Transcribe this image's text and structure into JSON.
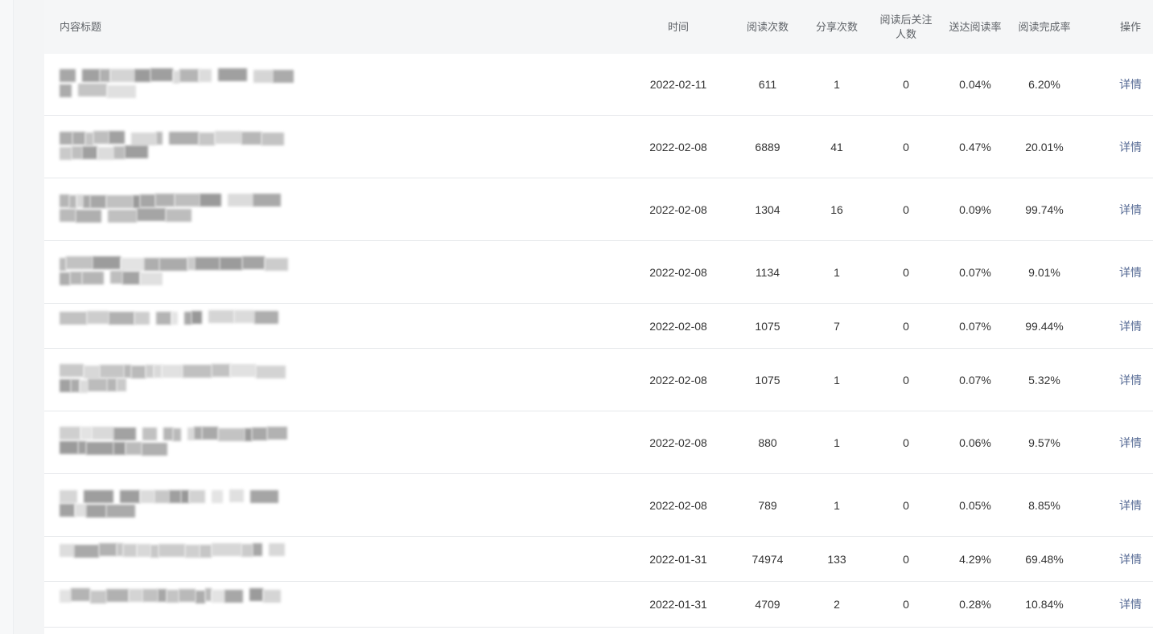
{
  "columns": {
    "title": "内容标题",
    "time": "时间",
    "reads": "阅读次数",
    "shares": "分享次数",
    "follows": "阅读后关注人数",
    "delivery_rate": "送达阅读率",
    "completion_rate": "阅读完成率",
    "action": "操作"
  },
  "rows": [
    {
      "time": "2022-02-11",
      "reads": "611",
      "shares": "1",
      "follows": "0",
      "delivery_rate": "0.04%",
      "completion_rate": "6.20%",
      "action": "详情"
    },
    {
      "time": "2022-02-08",
      "reads": "6889",
      "shares": "41",
      "follows": "0",
      "delivery_rate": "0.47%",
      "completion_rate": "20.01%",
      "action": "详情"
    },
    {
      "time": "2022-02-08",
      "reads": "1304",
      "shares": "16",
      "follows": "0",
      "delivery_rate": "0.09%",
      "completion_rate": "99.74%",
      "action": "详情"
    },
    {
      "time": "2022-02-08",
      "reads": "1134",
      "shares": "1",
      "follows": "0",
      "delivery_rate": "0.07%",
      "completion_rate": "9.01%",
      "action": "详情"
    },
    {
      "time": "2022-02-08",
      "reads": "1075",
      "shares": "7",
      "follows": "0",
      "delivery_rate": "0.07%",
      "completion_rate": "99.44%",
      "action": "详情"
    },
    {
      "time": "2022-02-08",
      "reads": "1075",
      "shares": "1",
      "follows": "0",
      "delivery_rate": "0.07%",
      "completion_rate": "5.32%",
      "action": "详情"
    },
    {
      "time": "2022-02-08",
      "reads": "880",
      "shares": "1",
      "follows": "0",
      "delivery_rate": "0.06%",
      "completion_rate": "9.57%",
      "action": "详情"
    },
    {
      "time": "2022-02-08",
      "reads": "789",
      "shares": "1",
      "follows": "0",
      "delivery_rate": "0.05%",
      "completion_rate": "8.85%",
      "action": "详情"
    },
    {
      "time": "2022-01-31",
      "reads": "74974",
      "shares": "133",
      "follows": "0",
      "delivery_rate": "4.29%",
      "completion_rate": "69.48%",
      "action": "详情"
    },
    {
      "time": "2022-01-31",
      "reads": "4709",
      "shares": "2",
      "follows": "0",
      "delivery_rate": "0.28%",
      "completion_rate": "10.84%",
      "action": "详情"
    }
  ]
}
